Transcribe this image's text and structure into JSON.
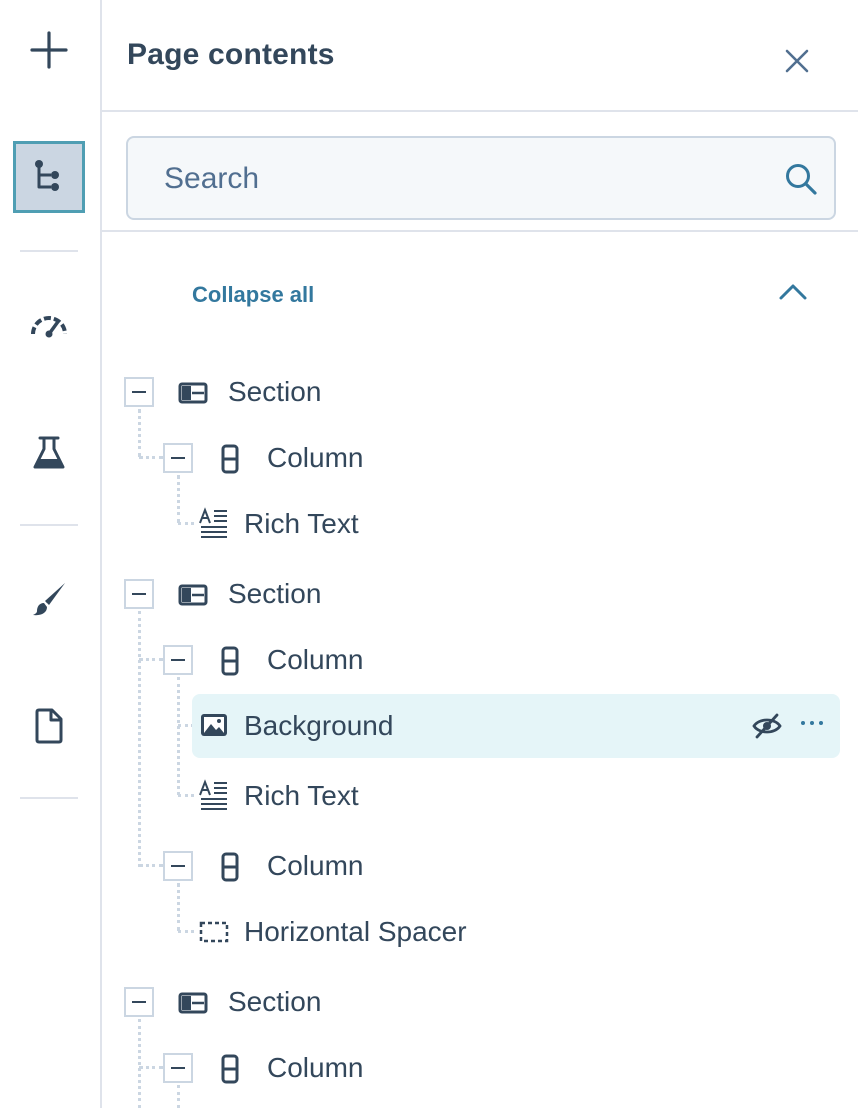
{
  "panel": {
    "title": "Page contents",
    "search_placeholder": "Search",
    "collapse_all_label": "Collapse all"
  },
  "rail": {
    "items": [
      "add-icon",
      "tree-icon",
      "gauge-icon",
      "flask-icon",
      "brush-icon",
      "page-icon"
    ],
    "active": "tree-icon"
  },
  "tree": [
    {
      "label": "Section",
      "type": "section",
      "expanded": true
    },
    {
      "label": "Column",
      "type": "column",
      "expanded": true
    },
    {
      "label": "Rich Text",
      "type": "rich-text"
    },
    {
      "label": "Section",
      "type": "section",
      "expanded": true
    },
    {
      "label": "Column",
      "type": "column",
      "expanded": true
    },
    {
      "label": "Background",
      "type": "image",
      "selected": true,
      "hidden": true
    },
    {
      "label": "Rich Text",
      "type": "rich-text"
    },
    {
      "label": "Column",
      "type": "column",
      "expanded": true
    },
    {
      "label": "Horizontal Spacer",
      "type": "spacer"
    },
    {
      "label": "Section",
      "type": "section",
      "expanded": true
    },
    {
      "label": "Column",
      "type": "column",
      "expanded": true
    }
  ],
  "colors": {
    "text": "#33475b",
    "accent": "#33789e",
    "border": "#cbd6e2",
    "highlight": "#e5f5f8",
    "active_rail": "#4f9eb3"
  }
}
